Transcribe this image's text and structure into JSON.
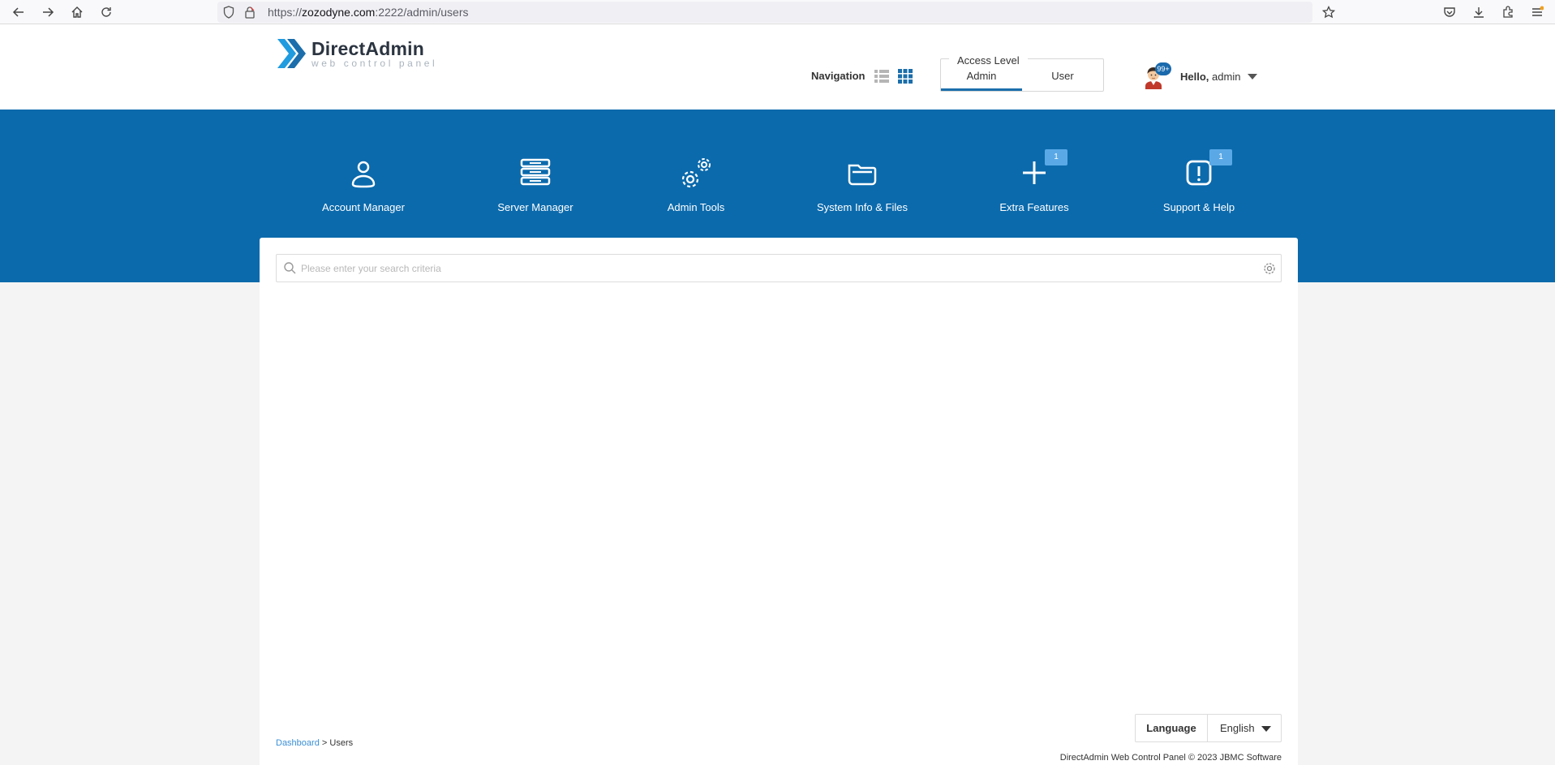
{
  "browser": {
    "url_prefix": "https://",
    "url_host": "zozodyne.com",
    "url_rest": ":2222/admin/users"
  },
  "logo": {
    "title": "DirectAdmin",
    "subtitle": "web control panel"
  },
  "header": {
    "navigation_label": "Navigation",
    "access_level": {
      "title": "Access Level",
      "tabs": [
        "Admin",
        "User"
      ],
      "active": "Admin"
    },
    "user": {
      "greeting": "Hello,",
      "name": "admin",
      "notifications_badge": "99+"
    }
  },
  "menu": [
    {
      "label": "Account Manager",
      "icon": "user-icon",
      "badge": ""
    },
    {
      "label": "Server Manager",
      "icon": "server-icon",
      "badge": ""
    },
    {
      "label": "Admin Tools",
      "icon": "gears-icon",
      "badge": ""
    },
    {
      "label": "System Info & Files",
      "icon": "folder-icon",
      "badge": ""
    },
    {
      "label": "Extra Features",
      "icon": "plus-icon",
      "badge": "1"
    },
    {
      "label": "Support & Help",
      "icon": "exclamation-icon",
      "badge": "1"
    }
  ],
  "search": {
    "placeholder": "Please enter your search criteria",
    "value": ""
  },
  "language": {
    "label": "Language",
    "value": "English"
  },
  "breadcrumb": {
    "root": "Dashboard",
    "separator": ">",
    "current": "Users"
  },
  "footer": {
    "text": "DirectAdmin Web Control Panel © 2023 JBMC Software"
  },
  "colors": {
    "brand_blue": "#0b6aac",
    "badge_blue": "#5aa9e6",
    "link_blue": "#3a8fd6"
  }
}
